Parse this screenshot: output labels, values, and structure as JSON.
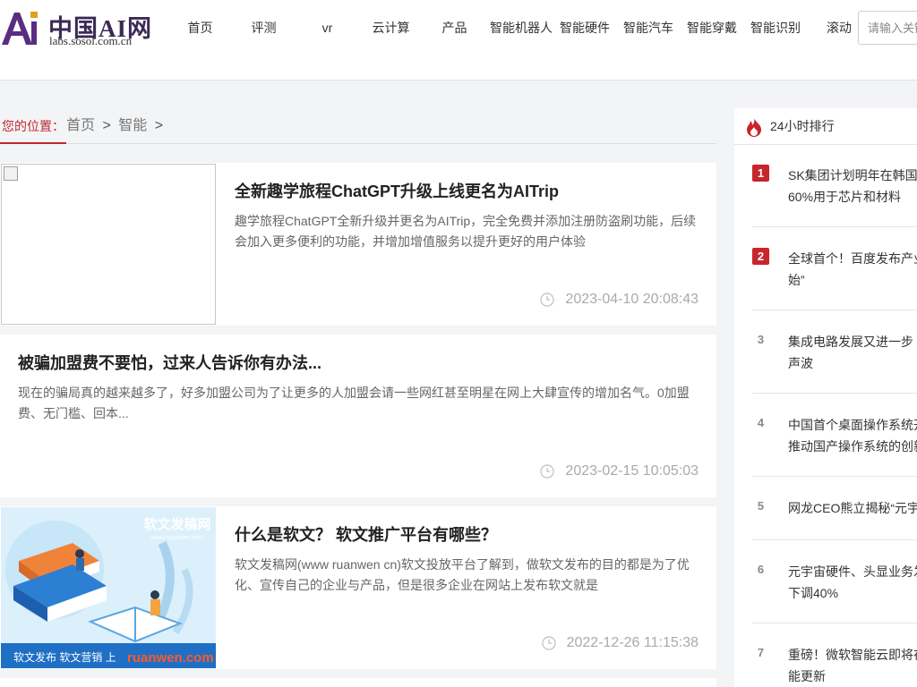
{
  "header": {
    "logo_title": "中国AI网",
    "logo_sub": "labs.sosol.com.cn",
    "brand_color": "#5a2d82",
    "nav": [
      "首页",
      "评测",
      "vr",
      "云计算",
      "产品",
      "智能机器人",
      "智能硬件",
      "智能汽车",
      "智能穿戴",
      "智能识别",
      "滚动"
    ],
    "search_placeholder": "请输入关键词"
  },
  "breadcrumb": {
    "label": "您的位置：",
    "items": [
      "首页",
      "智能"
    ],
    "sep": ">"
  },
  "articles": [
    {
      "title": "全新趣学旅程ChatGPT升级上线更名为AITrip",
      "desc": "趣学旅程ChatGPT全新升级并更名为AITrip，完全免费并添加注册防盗刷功能，后续会加入更多便利的功能，并增加增值服务以提升更好的用户体验",
      "time": "2023-04-10 20:08:43",
      "thumb": "broken-image"
    },
    {
      "title": "被骗加盟费不要怕，过来人告诉你有办法...",
      "desc": "现在的骗局真的越来越多了，好多加盟公司为了让更多的人加盟会请一些网红甚至明星在网上大肆宣传的增加名气。0加盟费、无门槛、回本...",
      "time": "2023-02-15 10:05:03"
    },
    {
      "title": "什么是软文？ 软文推广平台有哪些？",
      "desc": "软文发稿网(www ruanwen cn)软文投放平台了解到，做软文发布的目的都是为了优化、宣传自己的企业与产品，但是很多企业在网站上发布软文就是",
      "time": "2022-12-26 11:15:38",
      "thumb": "ruanwen-banner",
      "thumb_brand": "软文发稿网",
      "thumb_url": "www.ruanwen.com",
      "thumb_footer": "软文发布 软文营销 上",
      "thumb_domain": "ruanwen.com"
    }
  ],
  "sidebar": {
    "title": "24小时排行",
    "hot_color": "#c8252c",
    "items": [
      {
        "rank": "1",
        "text": "SK集团计划明年在韩国\n60%用于芯片和材料"
      },
      {
        "rank": "2",
        "text": "全球首个！百度发布产业\n始”"
      },
      {
        "rank": "3",
        "text": "集成电路发展又进一步\n声波"
      },
      {
        "rank": "4",
        "text": "中国首个桌面操作系统开\n推动国产操作系统的创新"
      },
      {
        "rank": "5",
        "text": "网龙CEO熊立揭秘“元宇"
      },
      {
        "rank": "6",
        "text": "元宇宙硬件、头显业务发\n下调40%"
      },
      {
        "rank": "7",
        "text": "重磅！微软智能云即将在\n能更新"
      }
    ]
  }
}
